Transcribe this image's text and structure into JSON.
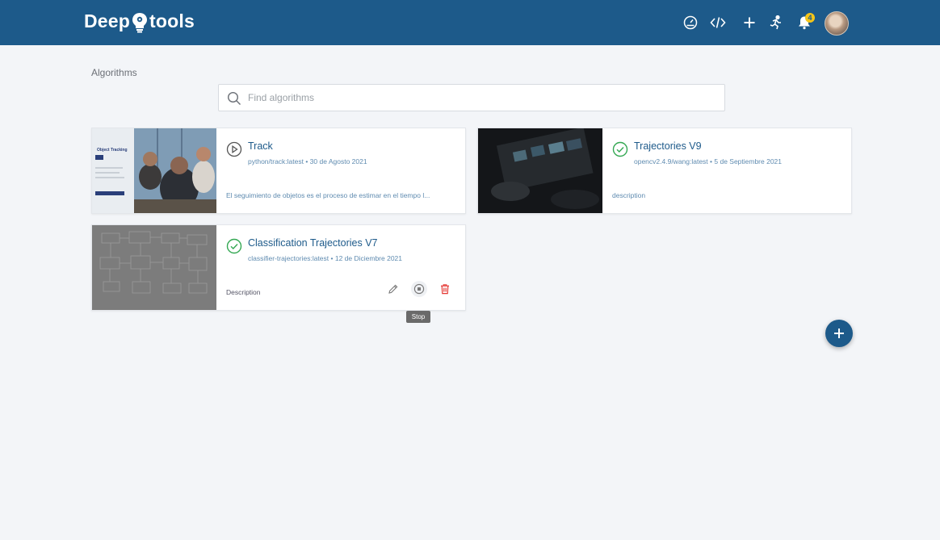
{
  "app": {
    "logo_left": "Deep",
    "logo_right": "tools",
    "notification_count": "4",
    "colors": {
      "primary": "#1d5a8a",
      "success": "#34a853",
      "danger": "#e53935",
      "badge": "#f5c518"
    }
  },
  "header_icons": [
    "dashboard-icon",
    "code-icon",
    "plus-icon",
    "runner-icon",
    "bell-icon",
    "avatar"
  ],
  "page": {
    "heading": "Algorithms",
    "search_placeholder": "Find algorithms"
  },
  "cards": [
    {
      "title": "Track",
      "meta": "python/track:latest  •  30 de Agosto 2021",
      "description": "El seguimiento de objetos es el proceso de estimar en el tiempo l...",
      "status": "play-circle-icon",
      "thumb_text": "Object Tracking"
    },
    {
      "title": "Trajectories V9",
      "meta": "opencv2.4.9/wang:latest  •  5 de Septiembre 2021",
      "description": "description",
      "status": "check-circle-icon"
    },
    {
      "title": "Classification Trajectories V7",
      "meta": "classifier-trajectories:latest  •  12 de Diciembre 2021",
      "description": "Description",
      "status": "check-circle-icon",
      "actions": [
        "edit-icon",
        "stop-icon",
        "delete-icon"
      ]
    }
  ],
  "tooltip": "Stop"
}
